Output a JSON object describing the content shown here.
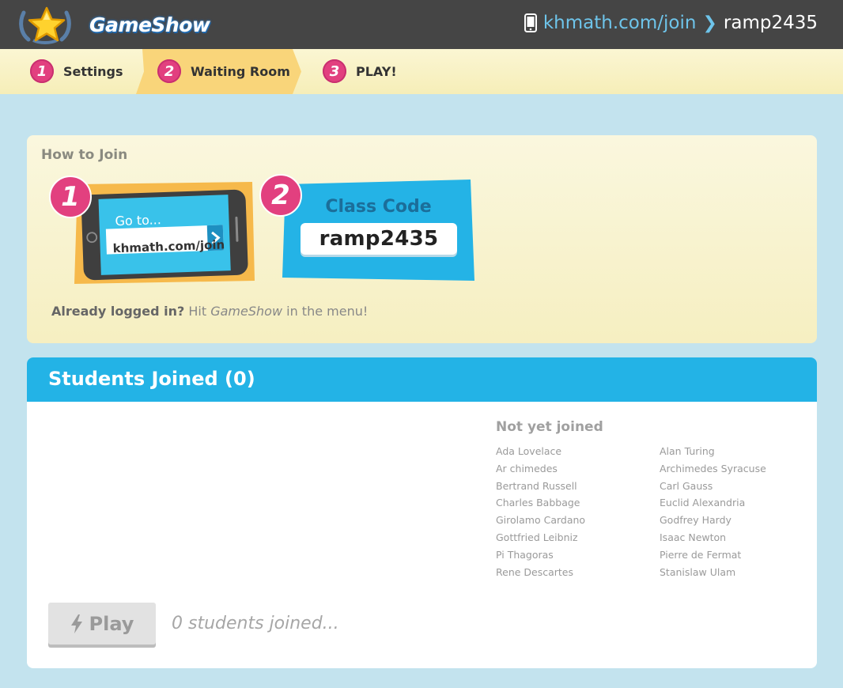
{
  "header": {
    "logo_text": "GameShow",
    "join_url": "khmath.com/join",
    "join_code": "ramp2435"
  },
  "steps": [
    {
      "number": "1",
      "label": "Settings",
      "active": false
    },
    {
      "number": "2",
      "label": "Waiting Room",
      "active": true
    },
    {
      "number": "3",
      "label": "PLAY!",
      "active": false
    }
  ],
  "how_to_join": {
    "title": "How to Join",
    "step1_number": "1",
    "step1_goto": "Go to...",
    "step1_url": "khmath.com/join",
    "step2_number": "2",
    "class_code_label": "Class Code",
    "class_code": "ramp2435",
    "logged_in_bold": "Already logged in?",
    "logged_in_hit": "Hit",
    "logged_in_app": "GameShow",
    "logged_in_rest": "in the menu!"
  },
  "students": {
    "title": "Students Joined (0)",
    "not_joined_title": "Not yet joined",
    "not_joined": [
      "Ada Lovelace",
      "Alan Turing",
      "Ar chimedes",
      "Archimedes Syracuse",
      "Bertrand Russell",
      "Carl Gauss",
      "Charles Babbage",
      "Euclid Alexandria",
      "Girolamo Cardano",
      "Godfrey Hardy",
      "Gottfried Leibniz",
      "Isaac Newton",
      "Pi Thagoras",
      "Pierre de Fermat",
      "Rene Descartes",
      "Stanislaw Ulam"
    ],
    "play_label": "Play",
    "joined_status": "0 students joined..."
  },
  "colors": {
    "topbar": "#454545",
    "accent_blue": "#23b3e6",
    "link_blue": "#6ec4ea",
    "step_pink": "#e2407f",
    "page_bg": "#c3e3ee",
    "step_active": "#f9d57a"
  }
}
